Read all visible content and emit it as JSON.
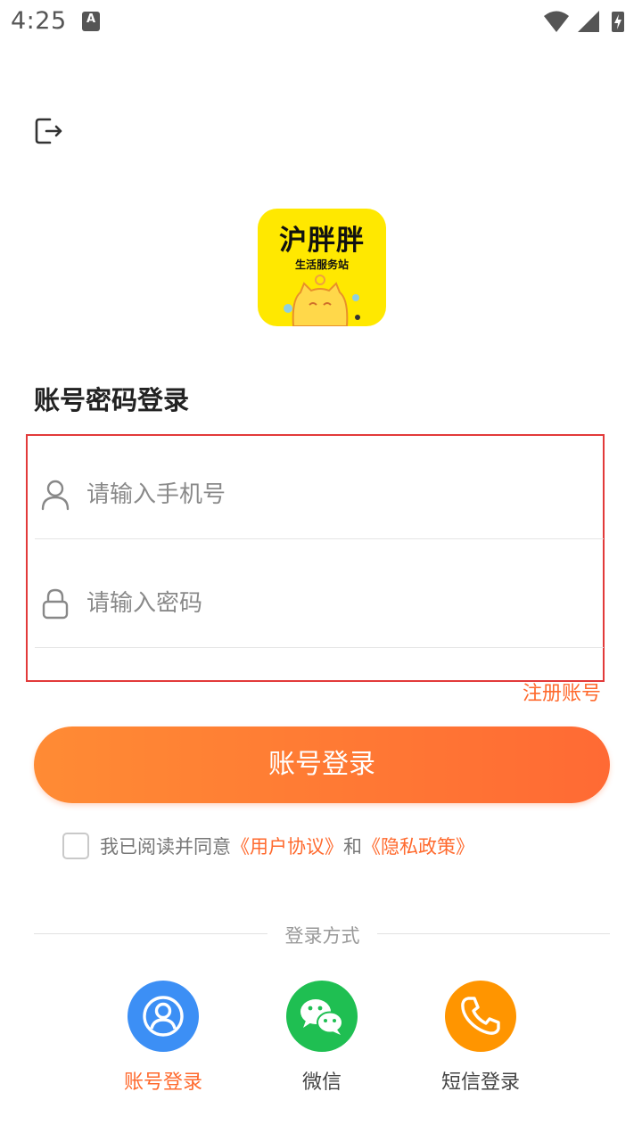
{
  "status_bar": {
    "time": "4:25",
    "notification_badge": "A"
  },
  "logo": {
    "name": "沪胖胖",
    "subtitle": "生活服务站"
  },
  "title": "账号密码登录",
  "form": {
    "phone_placeholder": "请输入手机号",
    "phone_value": "",
    "password_placeholder": "请输入密码",
    "password_value": ""
  },
  "register_link": "注册账号",
  "login_button": "账号登录",
  "agreement": {
    "checked": false,
    "prefix": "我已阅读并同意",
    "user_agreement": "《用户协议》",
    "and": "和",
    "privacy_policy": "《隐私政策》"
  },
  "divider_label": "登录方式",
  "methods": [
    {
      "label": "账号登录",
      "icon": "account-icon",
      "color": "#3c8ff5",
      "active": true
    },
    {
      "label": "微信",
      "icon": "wechat-icon",
      "color": "#1fbf52",
      "active": false
    },
    {
      "label": "短信登录",
      "icon": "phone-icon",
      "color": "#ff9500",
      "active": false
    }
  ],
  "colors": {
    "accent": "#ff6a2e",
    "highlight_border": "#e23a3a"
  }
}
